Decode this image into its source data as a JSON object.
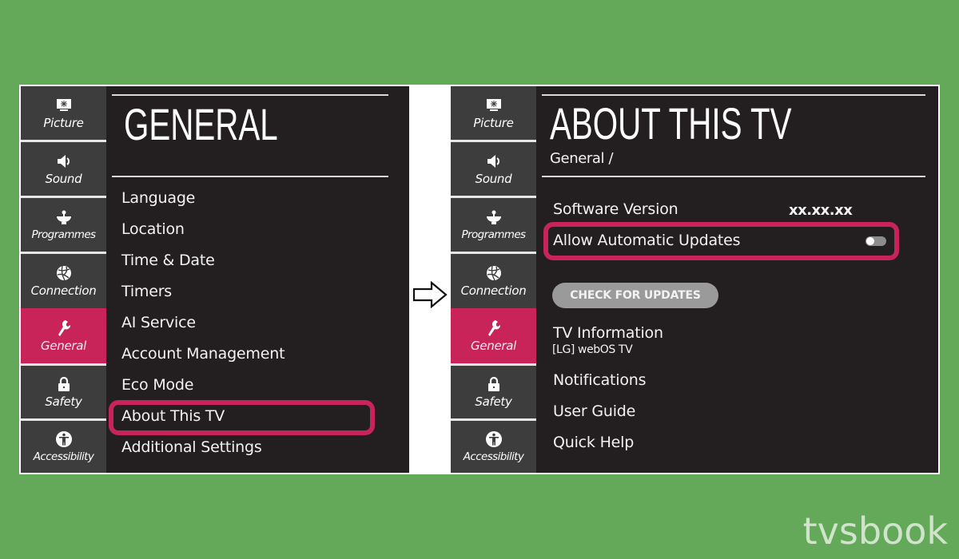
{
  "sidebar": {
    "items": [
      {
        "label": "Picture",
        "icon": "picture-icon"
      },
      {
        "label": "Sound",
        "icon": "speaker-icon"
      },
      {
        "label": "Programmes",
        "icon": "antenna-icon"
      },
      {
        "label": "Connection",
        "icon": "globe-icon"
      },
      {
        "label": "General",
        "icon": "wrench-icon",
        "active": true
      },
      {
        "label": "Safety",
        "icon": "lock-icon"
      },
      {
        "label": "Accessibility",
        "icon": "accessibility-icon"
      }
    ]
  },
  "left_panel": {
    "title": "GENERAL",
    "menu": [
      "Language",
      "Location",
      "Time & Date",
      "Timers",
      "AI Service",
      "Account Management",
      "Eco Mode",
      "About This TV",
      "Additional Settings"
    ],
    "highlighted_item": "About This TV"
  },
  "right_panel": {
    "title": "ABOUT THIS TV",
    "breadcrumb": "General /",
    "software_version_label": "Software Version",
    "software_version_value": "xx.xx.xx",
    "auto_updates_label": "Allow Automatic Updates",
    "auto_updates_enabled": false,
    "check_updates_button": "CHECK FOR UPDATES",
    "tv_information_label": "TV Information",
    "tv_information_sub": "[LG] webOS TV",
    "notifications_label": "Notifications",
    "user_guide_label": "User Guide",
    "quick_help_label": "Quick Help"
  },
  "colors": {
    "accent": "#c8245a",
    "panel_bg": "#231f20",
    "sidebar_bg": "#3d3d3d",
    "page_bg": "#64a959"
  },
  "watermark": "tvsbook"
}
